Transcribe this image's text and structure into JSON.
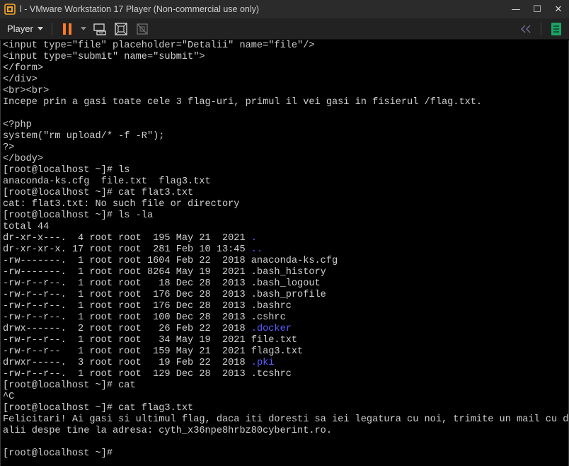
{
  "window": {
    "title": "l - VMware Workstation 17 Player (Non-commercial use only)",
    "minimize_glyph": "—",
    "maximize_glyph": "☐",
    "close_glyph": "✕",
    "icon": "vmware-player-icon"
  },
  "toolbar": {
    "player_label": "Player",
    "icons": [
      "pause-icon",
      "send-ctrl-alt-del-icon",
      "fullscreen-icon",
      "unity-icon",
      "collapse-icon",
      "library-icon"
    ],
    "accent_color": "#ff7a29",
    "library_color": "#1ea364"
  },
  "console": {
    "lines": [
      {
        "text": "<input type=\"file\" placeholder=\"Detalii\" name=\"file\"/>"
      },
      {
        "text": "<input type=\"submit\" name=\"submit\">"
      },
      {
        "text": "</form>"
      },
      {
        "text": "</div>"
      },
      {
        "text": "<br><br>"
      },
      {
        "text": "Incepe prin a gasi toate cele 3 flag-uri, primul il vei gasi in fisierul /flag.txt."
      },
      {
        "text": ""
      },
      {
        "text": "<?php"
      },
      {
        "text": "system(\"rm upload/* -f -R\");"
      },
      {
        "text": "?>"
      },
      {
        "text": "</body>"
      },
      {
        "text": "[root@localhost ~]# ls"
      },
      {
        "text": "anaconda-ks.cfg  file.txt  flag3.txt"
      },
      {
        "text": "[root@localhost ~]# cat flat3.txt"
      },
      {
        "text": "cat: flat3.txt: No such file or directory"
      },
      {
        "text": "[root@localhost ~]# ls -la"
      },
      {
        "text": "total 44"
      },
      {
        "text": "dr-xr-x---.  4 root root  195 May 21  2021 ",
        "name": "."
      },
      {
        "text": "dr-xr-xr-x. 17 root root  281 Feb 10 13:45 ",
        "name": ".."
      },
      {
        "text": "-rw-------.  1 root root 1604 Feb 22  2018 anaconda-ks.cfg"
      },
      {
        "text": "-rw-------.  1 root root 8264 May 19  2021 .bash_history"
      },
      {
        "text": "-rw-r--r--.  1 root root   18 Dec 28  2013 .bash_logout"
      },
      {
        "text": "-rw-r--r--.  1 root root  176 Dec 28  2013 .bash_profile"
      },
      {
        "text": "-rw-r--r--.  1 root root  176 Dec 28  2013 .bashrc"
      },
      {
        "text": "-rw-r--r--.  1 root root  100 Dec 28  2013 .cshrc"
      },
      {
        "text": "drwx------.  2 root root   26 Feb 22  2018 ",
        "name": ".docker"
      },
      {
        "text": "-rw-r--r--.  1 root root   34 May 19  2021 file.txt"
      },
      {
        "text": "-rw-r--r--   1 root root  159 May 21  2021 flag3.txt"
      },
      {
        "text": "drwxr-----.  3 root root   19 Feb 22  2018 ",
        "name": ".pki"
      },
      {
        "text": "-rw-r--r--.  1 root root  129 Dec 28  2013 .tcshrc"
      },
      {
        "text": "[root@localhost ~]# cat"
      },
      {
        "text": "^C"
      },
      {
        "text": "[root@localhost ~]# cat flag3.txt"
      },
      {
        "text": "Felicitari! Ai gasi si ultimul flag, daca iti doresti sa iei legatura cu noi, trimite un mail cu det"
      },
      {
        "text": "alii despe tine la adresa: cyth_x36npe8hrbz80cyberint.ro."
      },
      {
        "text": ""
      },
      {
        "text": "[root@localhost ~]# "
      }
    ],
    "text_color": "#d0d0d0",
    "dir_color": "#5c5cff",
    "background": "#000000"
  }
}
